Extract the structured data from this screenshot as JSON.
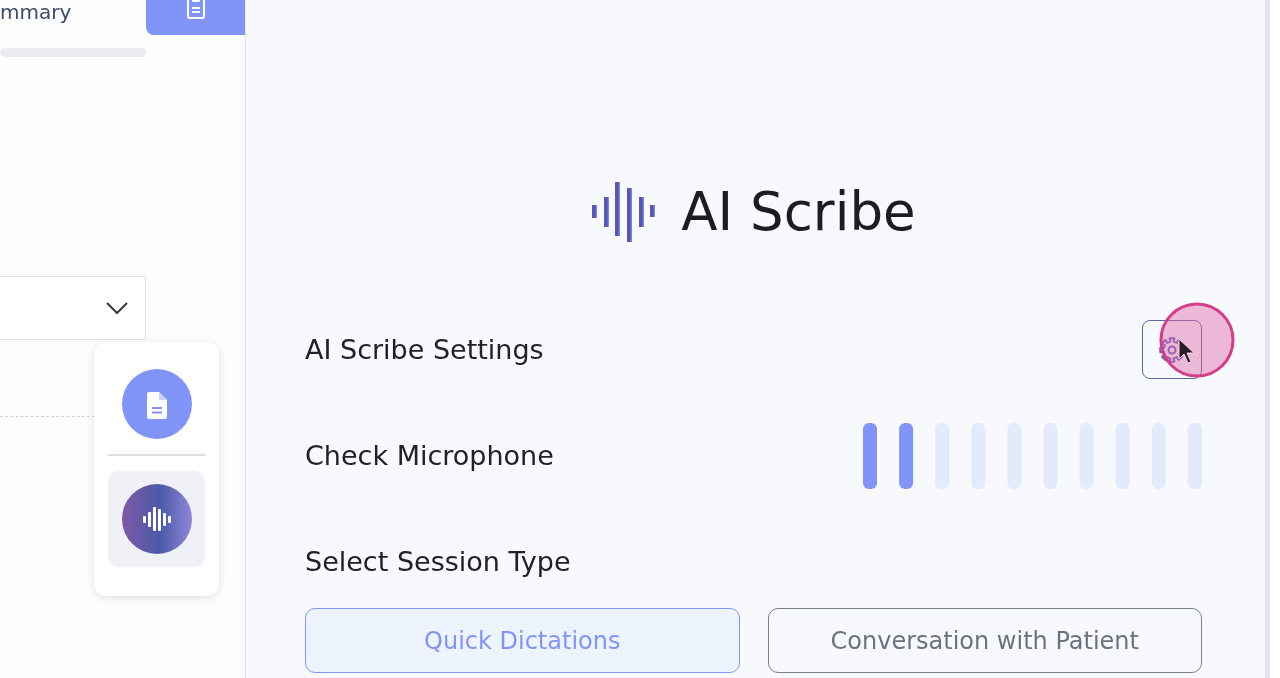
{
  "left_panel": {
    "tab_label": "mmary"
  },
  "tool_panel": {
    "tools": [
      {
        "kind": "document",
        "selected": false
      },
      {
        "kind": "scribe",
        "selected": true
      }
    ]
  },
  "title": "AI Scribe",
  "settings": {
    "label": "AI Scribe Settings"
  },
  "microphone": {
    "label": "Check Microphone",
    "level": 0.2
  },
  "session": {
    "label": "Select Session Type",
    "options": [
      {
        "label": "Quick Dictations",
        "selected": true
      },
      {
        "label": "Conversation with Patient",
        "selected": false
      }
    ]
  }
}
